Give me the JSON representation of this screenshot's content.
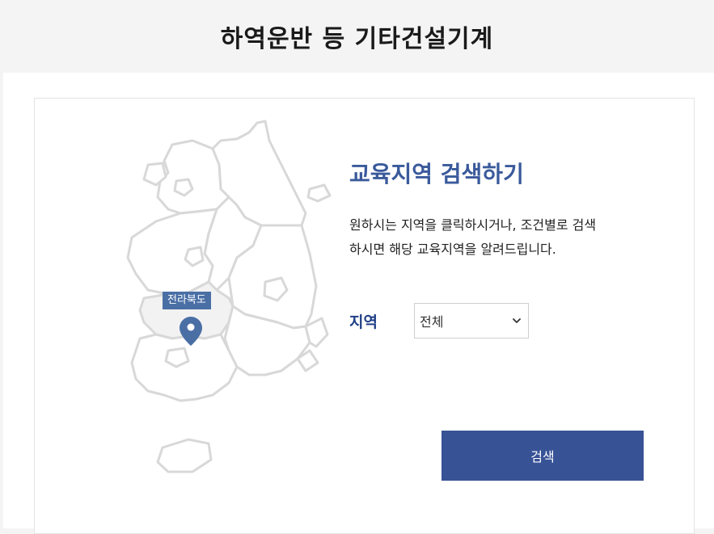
{
  "page": {
    "title": "하역운반 등 기타건설기계"
  },
  "search": {
    "title": "교육지역 검색하기",
    "description_line1": "원하시는 지역을 클릭하시거나, 조건별로 검색",
    "description_line2": "하시면 해당 교육지역을 알려드립니다.",
    "region_label": "지역",
    "region_selected": "전체",
    "button_label": "검색"
  },
  "map": {
    "selected_region": "전라북도",
    "icon": "map-pin-icon"
  },
  "colors": {
    "accent": "#385296",
    "title": "#3a5a9b",
    "pin": "#4a6fa5",
    "map_fill": "#ffffff",
    "map_border": "#d8d8d8",
    "selected_fill": "#f2f2f2"
  }
}
